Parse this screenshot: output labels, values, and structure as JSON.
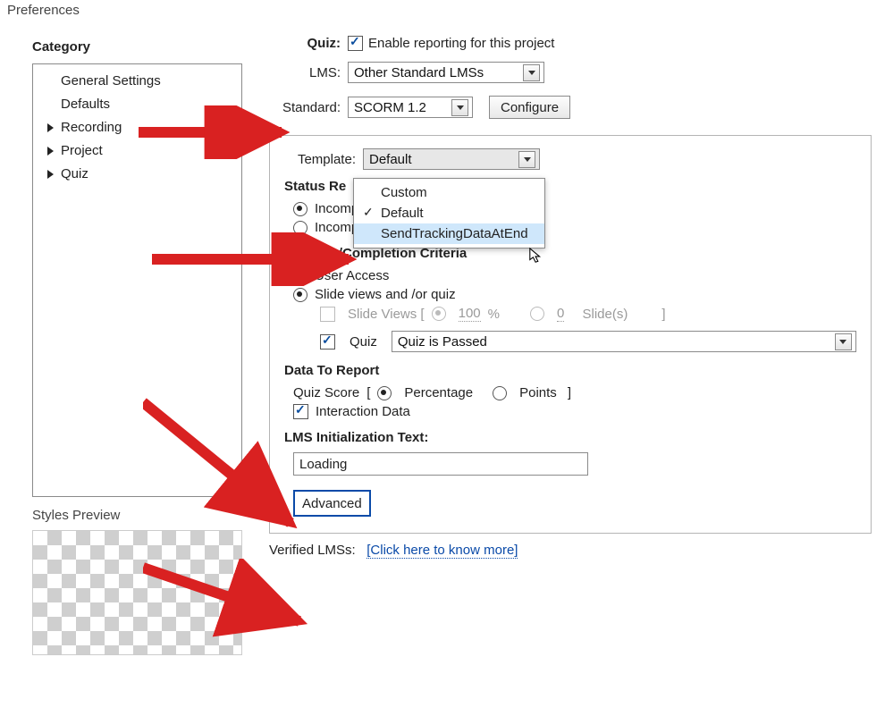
{
  "window": {
    "title": "Preferences"
  },
  "category": {
    "heading": "Category",
    "items": [
      {
        "label": "General Settings",
        "expandable": false
      },
      {
        "label": "Defaults",
        "expandable": false
      },
      {
        "label": "Recording",
        "expandable": true
      },
      {
        "label": "Project",
        "expandable": true
      },
      {
        "label": "Quiz",
        "expandable": true
      }
    ],
    "styles_preview_label": "Styles Preview"
  },
  "quiz": {
    "label": "Quiz:",
    "enable_reporting": "Enable reporting for this project",
    "lms_label": "LMS:",
    "lms_value": "Other Standard LMSs",
    "standard_label": "Standard:",
    "standard_value": "SCORM 1.2",
    "configure_btn": "Configure",
    "template_label": "Template:",
    "template_value": "Default",
    "template_options": [
      "Custom",
      "Default",
      "SendTrackingDataAtEnd"
    ],
    "template_selected_index": 1,
    "template_hover_index": 2,
    "status": {
      "heading_truncated": "Status Re",
      "opt1_truncated": "Incomp",
      "opt2_full": "Incomplete ---> Passed/Failed"
    },
    "success": {
      "heading": "Success/Completion Criteria",
      "user_access": "User Access",
      "slide_quiz": "Slide views and /or quiz",
      "slide_views_label": "Slide Views [",
      "slide_views_pct": "100",
      "slide_views_pct_suffix": "%",
      "slide_count": "0",
      "slide_count_suffix": "Slide(s)",
      "bracket_close": "]",
      "quiz_label": "Quiz",
      "quiz_value": "Quiz is Passed"
    },
    "data_report": {
      "heading": "Data To Report",
      "quiz_score_label": "Quiz Score",
      "percentage": "Percentage",
      "points": "Points",
      "interaction_data": "Interaction Data"
    },
    "lms_init": {
      "heading": "LMS Initialization Text:",
      "value": "Loading"
    },
    "advanced_btn": "Advanced",
    "verified_label": "Verified LMSs:",
    "verified_link": "[Click here to know more]"
  }
}
